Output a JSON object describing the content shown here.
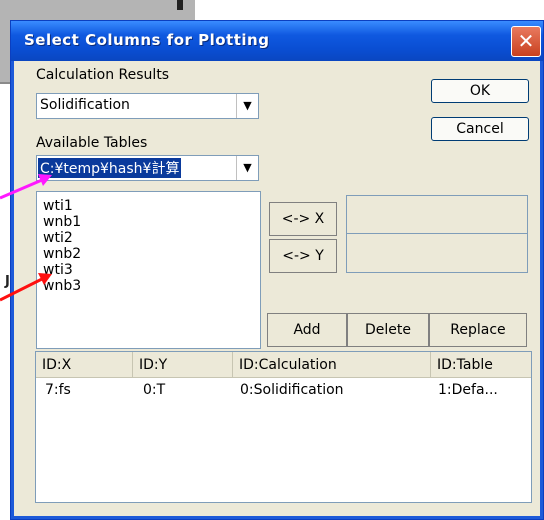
{
  "dialog": {
    "title": "Select Columns for Plotting",
    "close_label": "✕"
  },
  "calculation_results": {
    "label": "Calculation Results",
    "value": "Solidification"
  },
  "available_tables": {
    "label": "Available Tables",
    "value": "C:¥temp¥hash¥計算"
  },
  "dropdown_arrow": "▼",
  "buttons": {
    "ok": "OK",
    "cancel": "Cancel",
    "x_axis": "<-> X",
    "y_axis": "<-> Y",
    "add": "Add",
    "delete": "Delete",
    "replace": "Replace"
  },
  "columns_list": [
    "wti1",
    "wnb1",
    "wti2",
    "wnb2",
    "wti3",
    "wnb3"
  ],
  "table": {
    "headers": [
      "ID:X",
      "ID:Y",
      "ID:Calculation",
      "ID:Table"
    ],
    "rows": [
      [
        "7:fs",
        "0:T",
        "0:Solidification",
        "1:Defa..."
      ]
    ]
  },
  "background_fragment": "J"
}
